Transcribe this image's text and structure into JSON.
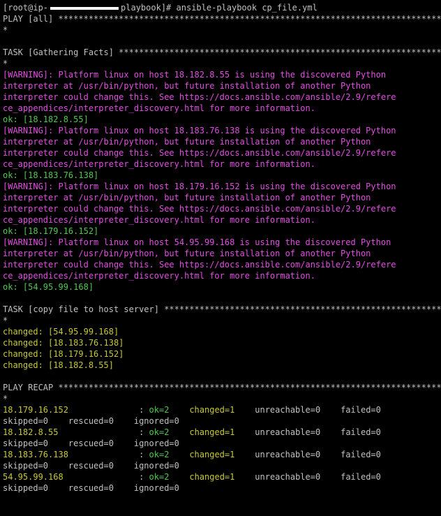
{
  "terminal": {
    "prompt_prefix": "[root@ip-",
    "prompt_suffix": "playbook]# ",
    "command": "ansible-playbook cp_file.yml"
  },
  "colors": {
    "background": "#000000",
    "default_text": "#c0c0c0",
    "ok_text": "#4ec94e",
    "warning_text": "#e14ee1",
    "changed_text": "#c8c832"
  },
  "lines": [
    {
      "segments": [
        {
          "t": "PLAY [all] ******************************************************************************",
          "c": "w"
        }
      ]
    },
    {
      "segments": [
        {
          "t": "*",
          "c": "w"
        }
      ]
    },
    {
      "segments": []
    },
    {
      "segments": [
        {
          "t": "TASK [Gathering Facts] ******************************************************************",
          "c": "w"
        }
      ]
    },
    {
      "segments": [
        {
          "t": "*",
          "c": "w"
        }
      ]
    },
    {
      "segments": [
        {
          "t": "[WARNING]: Platform linux on host 18.182.8.55 is using the discovered Python",
          "c": "m"
        }
      ]
    },
    {
      "segments": [
        {
          "t": "interpreter at /usr/bin/python, but future installation of another Python",
          "c": "m"
        }
      ]
    },
    {
      "segments": [
        {
          "t": "interpreter could change this. See https://docs.ansible.com/ansible/2.9/refere",
          "c": "m"
        }
      ]
    },
    {
      "segments": [
        {
          "t": "ce_appendices/interpreter_discovery.html for more information.",
          "c": "m"
        }
      ]
    },
    {
      "segments": [
        {
          "t": "ok: [18.182.8.55]",
          "c": "g"
        }
      ]
    },
    {
      "segments": [
        {
          "t": "[WARNING]: Platform linux on host 18.183.76.138 is using the discovered Python",
          "c": "m"
        }
      ]
    },
    {
      "segments": [
        {
          "t": "interpreter at /usr/bin/python, but future installation of another Python",
          "c": "m"
        }
      ]
    },
    {
      "segments": [
        {
          "t": "interpreter could change this. See https://docs.ansible.com/ansible/2.9/refere",
          "c": "m"
        }
      ]
    },
    {
      "segments": [
        {
          "t": "ce_appendices/interpreter_discovery.html for more information.",
          "c": "m"
        }
      ]
    },
    {
      "segments": [
        {
          "t": "ok: [18.183.76.138]",
          "c": "g"
        }
      ]
    },
    {
      "segments": [
        {
          "t": "[WARNING]: Platform linux on host 18.179.16.152 is using the discovered Python",
          "c": "m"
        }
      ]
    },
    {
      "segments": [
        {
          "t": "interpreter at /usr/bin/python, but future installation of another Python",
          "c": "m"
        }
      ]
    },
    {
      "segments": [
        {
          "t": "interpreter could change this. See https://docs.ansible.com/ansible/2.9/refere",
          "c": "m"
        }
      ]
    },
    {
      "segments": [
        {
          "t": "ce_appendices/interpreter_discovery.html for more information.",
          "c": "m"
        }
      ]
    },
    {
      "segments": [
        {
          "t": "ok: [18.179.16.152]",
          "c": "g"
        }
      ]
    },
    {
      "segments": [
        {
          "t": "[WARNING]: Platform linux on host 54.95.99.168 is using the discovered Python",
          "c": "m"
        }
      ]
    },
    {
      "segments": [
        {
          "t": "interpreter at /usr/bin/python, but future installation of another Python",
          "c": "m"
        }
      ]
    },
    {
      "segments": [
        {
          "t": "interpreter could change this. See https://docs.ansible.com/ansible/2.9/refere",
          "c": "m"
        }
      ]
    },
    {
      "segments": [
        {
          "t": "ce_appendices/interpreter_discovery.html for more information.",
          "c": "m"
        }
      ]
    },
    {
      "segments": [
        {
          "t": "ok: [54.95.99.168]",
          "c": "g"
        }
      ]
    },
    {
      "segments": []
    },
    {
      "segments": [
        {
          "t": "TASK [copy file to host server] *********************************************************",
          "c": "w"
        }
      ]
    },
    {
      "segments": [
        {
          "t": "*",
          "c": "w"
        }
      ]
    },
    {
      "segments": [
        {
          "t": "changed: [54.95.99.168]",
          "c": "y"
        }
      ]
    },
    {
      "segments": [
        {
          "t": "changed: [18.183.76.138]",
          "c": "y"
        }
      ]
    },
    {
      "segments": [
        {
          "t": "changed: [18.179.16.152]",
          "c": "y"
        }
      ]
    },
    {
      "segments": [
        {
          "t": "changed: [18.182.8.55]",
          "c": "y"
        }
      ]
    },
    {
      "segments": []
    },
    {
      "segments": [
        {
          "t": "PLAY RECAP ******************************************************************************",
          "c": "w"
        }
      ]
    },
    {
      "segments": [
        {
          "t": "*",
          "c": "w"
        }
      ]
    },
    {
      "segments": [
        {
          "t": "18.179.16.152",
          "c": "y"
        },
        {
          "t": "              : ",
          "c": "w"
        },
        {
          "t": "ok=2",
          "c": "g"
        },
        {
          "t": "    ",
          "c": "w"
        },
        {
          "t": "changed=1",
          "c": "y"
        },
        {
          "t": "    unreachable=0    failed=0",
          "c": "w"
        }
      ]
    },
    {
      "segments": [
        {
          "t": "skipped=0    rescued=0    ignored=0",
          "c": "w"
        }
      ]
    },
    {
      "segments": [
        {
          "t": "18.182.8.55",
          "c": "y"
        },
        {
          "t": "                : ",
          "c": "w"
        },
        {
          "t": "ok=2",
          "c": "g"
        },
        {
          "t": "    ",
          "c": "w"
        },
        {
          "t": "changed=1",
          "c": "y"
        },
        {
          "t": "    unreachable=0    failed=0",
          "c": "w"
        }
      ]
    },
    {
      "segments": [
        {
          "t": "skipped=0    rescued=0    ignored=0",
          "c": "w"
        }
      ]
    },
    {
      "segments": [
        {
          "t": "18.183.76.138",
          "c": "y"
        },
        {
          "t": "              : ",
          "c": "w"
        },
        {
          "t": "ok=2",
          "c": "g"
        },
        {
          "t": "    ",
          "c": "w"
        },
        {
          "t": "changed=1",
          "c": "y"
        },
        {
          "t": "    unreachable=0    failed=0",
          "c": "w"
        }
      ]
    },
    {
      "segments": [
        {
          "t": "skipped=0    rescued=0    ignored=0",
          "c": "w"
        }
      ]
    },
    {
      "segments": [
        {
          "t": "54.95.99.168",
          "c": "y"
        },
        {
          "t": "               : ",
          "c": "w"
        },
        {
          "t": "ok=2",
          "c": "g"
        },
        {
          "t": "    ",
          "c": "w"
        },
        {
          "t": "changed=1",
          "c": "y"
        },
        {
          "t": "    unreachable=0    failed=0",
          "c": "w"
        }
      ]
    },
    {
      "segments": [
        {
          "t": "skipped=0    rescued=0    ignored=0",
          "c": "w"
        }
      ]
    }
  ]
}
